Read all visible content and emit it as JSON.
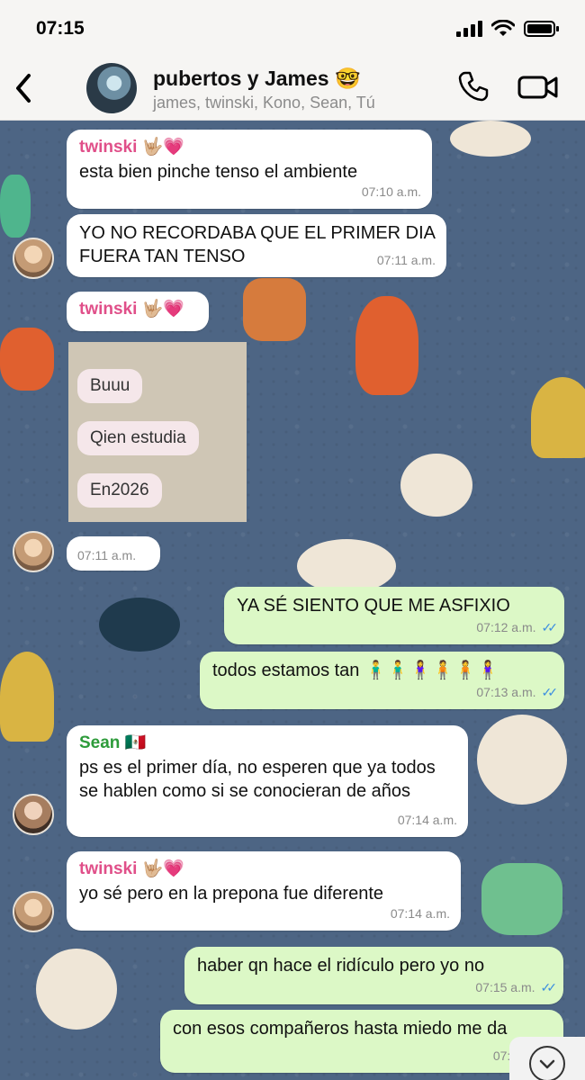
{
  "status_bar": {
    "time": "07:15"
  },
  "header": {
    "title": "pubertos y James 🤓",
    "subtitle": "james, twinski, Kono, Sean, Tú"
  },
  "messages": [
    {
      "sender": "twinski 🤟🏼💗",
      "text": "esta bien pinche tenso el ambiente",
      "time": "07:10 a.m."
    },
    {
      "text": "YO NO RECORDABA QUE EL PRIMER DIA FUERA TAN TENSO",
      "time": "07:11 a.m."
    },
    {
      "sender": "twinski 🤟🏼💗"
    },
    {
      "image_pills": [
        "Buuu",
        "Qien estudia",
        "En2026"
      ],
      "time": "07:11 a.m."
    },
    {
      "text": "YA SÉ SIENTO QUE ME ASFIXIO",
      "time": "07:12 a.m."
    },
    {
      "text": "todos estamos tan 🧍‍♂️🧍‍♂️🧍‍♀️🧍🧍🧍‍♀️",
      "time": "07:13 a.m."
    },
    {
      "sender": "Sean 🇲🇽",
      "text": "ps es el primer día, no esperen que ya todos se hablen como si se conocieran de años",
      "time": "07:14 a.m."
    },
    {
      "sender": "twinski 🤟🏼💗",
      "text": "yo sé pero en la prepona fue diferente",
      "time": "07:14 a.m."
    },
    {
      "text": "haber qn hace el ridículo pero yo no",
      "time": "07:15 a.m."
    },
    {
      "text": "con esos compañeros hasta miedo me da",
      "time": "07:15 a.m."
    }
  ],
  "colors": {
    "incoming": "#ffffff",
    "outgoing": "#dcf8c6",
    "read_ticks": "#3d8fe0",
    "twinski_name": "#e04f89",
    "sean_name": "#2d9b3a"
  }
}
